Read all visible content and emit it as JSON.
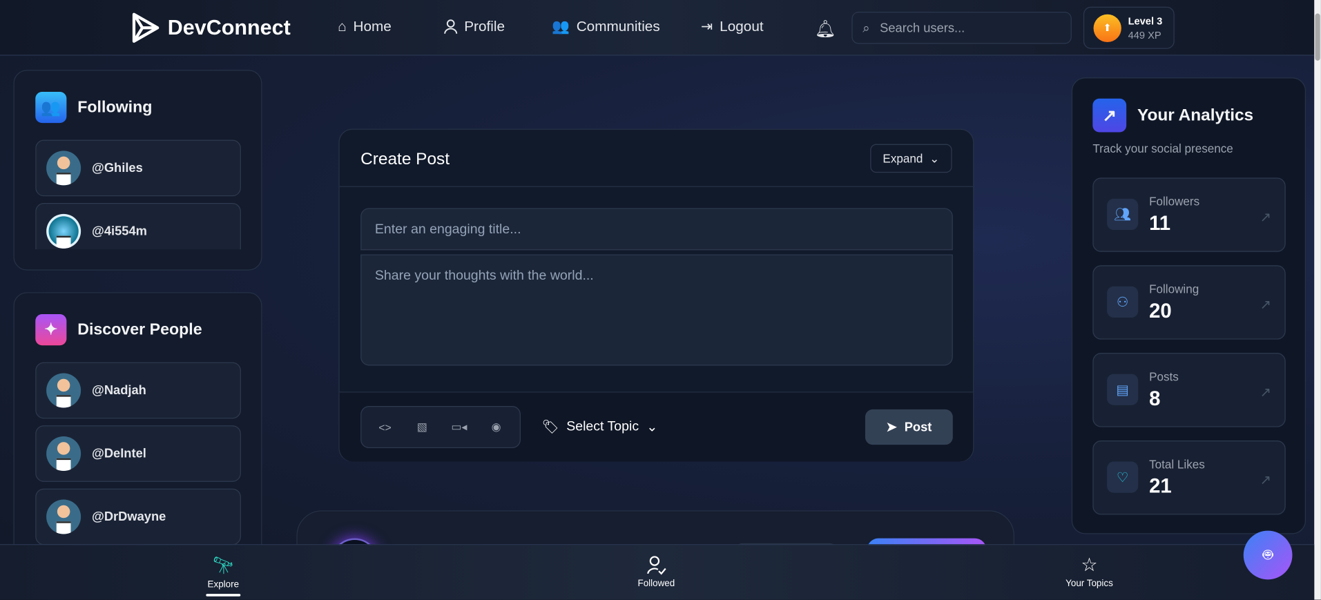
{
  "header": {
    "brand": "DevConnect",
    "nav": [
      {
        "label": "Home"
      },
      {
        "label": "Profile"
      },
      {
        "label": "Communities"
      },
      {
        "label": "Logout"
      }
    ],
    "search_placeholder": "Search users...",
    "level": "Level 3",
    "xp": "449 XP"
  },
  "following": {
    "title": "Following",
    "users": [
      "@Ghiles",
      "@4i554m"
    ]
  },
  "discover": {
    "title": "Discover People",
    "users": [
      "@Nadjah",
      "@DeIntel",
      "@DrDwayne"
    ]
  },
  "create_post": {
    "title": "Create Post",
    "expand": "Expand",
    "title_placeholder": "Enter an engaging title...",
    "body_placeholder": "Share your thoughts with the world...",
    "topic": "Select Topic",
    "post": "Post"
  },
  "analytics": {
    "title": "Your Analytics",
    "subtitle": "Track your social presence",
    "stats": [
      {
        "label": "Followers",
        "value": "11"
      },
      {
        "label": "Following",
        "value": "20"
      },
      {
        "label": "Posts",
        "value": "8"
      },
      {
        "label": "Total Likes",
        "value": "21"
      }
    ]
  },
  "bottom_nav": [
    {
      "label": "Explore"
    },
    {
      "label": "Followed"
    },
    {
      "label": "Your Topics"
    }
  ],
  "colors": {
    "accent": "#3b82f6",
    "purple": "#a855f7"
  }
}
